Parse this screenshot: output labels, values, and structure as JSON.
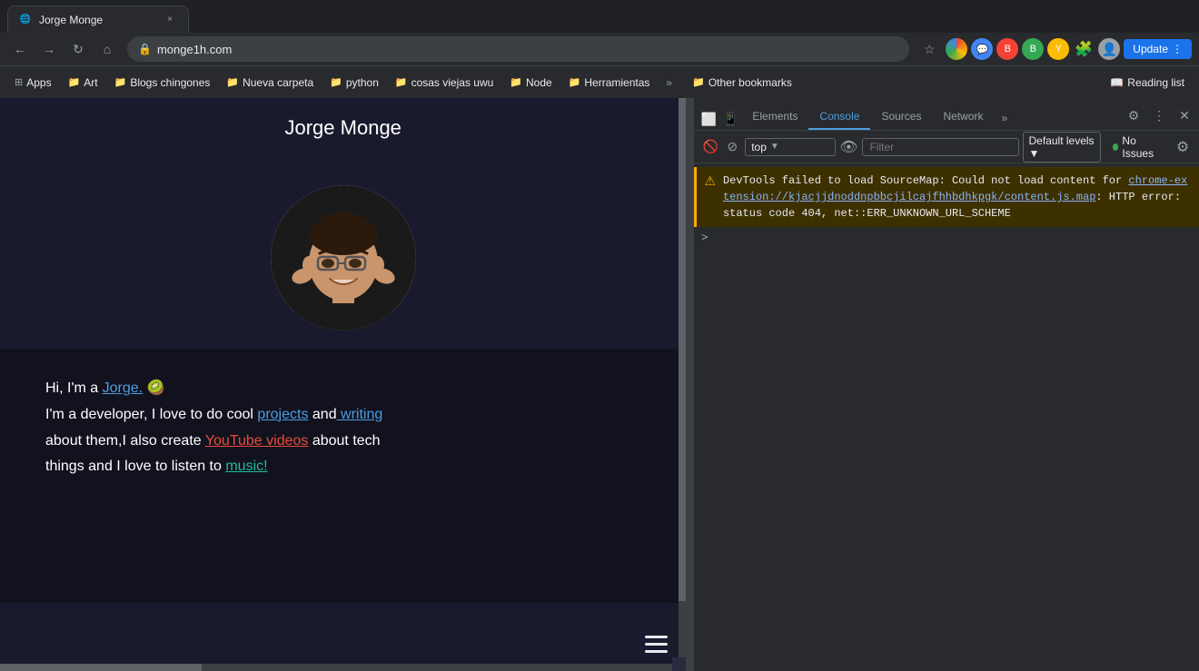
{
  "browser": {
    "address": "monge1h.com",
    "tab_title": "Jorge Monge",
    "back_tooltip": "Back",
    "forward_tooltip": "Forward",
    "refresh_tooltip": "Refresh",
    "home_tooltip": "Home"
  },
  "bookmarks": {
    "items": [
      {
        "id": "apps",
        "icon": "🔲",
        "label": "Apps"
      },
      {
        "id": "art",
        "icon": "📁",
        "label": "Art"
      },
      {
        "id": "blogs",
        "icon": "📁",
        "label": "Blogs chingones"
      },
      {
        "id": "nueva",
        "icon": "📁",
        "label": "Nueva carpeta"
      },
      {
        "id": "python",
        "icon": "📁",
        "label": "python"
      },
      {
        "id": "cosas",
        "icon": "📁",
        "label": "cosas viejas uwu"
      },
      {
        "id": "node",
        "icon": "📁",
        "label": "Node"
      },
      {
        "id": "herramientas",
        "icon": "📁",
        "label": "Herramientas"
      }
    ],
    "more_label": "»",
    "other_bookmarks_label": "Other bookmarks",
    "reading_list_label": "Reading list"
  },
  "website": {
    "title": "Jorge Monge",
    "intro_line1": "Hi, I'm a ",
    "intro_name": "Jorge.",
    "intro_emoji": "🥝",
    "intro_line2": "I'm a developer, I love to do cool ",
    "intro_projects": "projects",
    "intro_and": " and",
    "intro_writing": " writing",
    "intro_line3": " about them,I also create ",
    "intro_youtube": "YouTube videos",
    "intro_line4": " about tech",
    "intro_line5": "things and I love to listen to ",
    "intro_music": "music!",
    "hamburger_label": "menu"
  },
  "devtools": {
    "tabs": [
      {
        "id": "elements",
        "label": "Elements"
      },
      {
        "id": "console",
        "label": "Console",
        "active": true
      },
      {
        "id": "sources",
        "label": "Sources"
      },
      {
        "id": "network",
        "label": "Network"
      }
    ],
    "more_tabs_label": "»",
    "context_selector": "top",
    "filter_placeholder": "Filter",
    "default_levels_label": "Default levels ▼",
    "no_issues_label": "No Issues",
    "warning": {
      "message": "DevTools failed to load SourceMap: Could not load content for ",
      "link_text": "chrome-extension://kjacjjdnoddnpbbcjilcajfhhbdhkpgk/content.js.map",
      "message2": ": HTTP error: status code 404, net::ERR_UNKNOWN_URL_SCHEME"
    },
    "close_label": "×",
    "settings_label": "⚙",
    "undock_label": "⋮"
  },
  "colors": {
    "website_bg": "#1a1a2e",
    "website_content_bg": "#12121f",
    "devtools_bg": "#292a2d",
    "warning_bg": "#3d3000",
    "warning_border": "#f9ab00",
    "accent_blue": "#4d9de0",
    "accent_green": "#2ecc71",
    "accent_red": "#e74c3c",
    "accent_teal": "#1abc9c",
    "link_color": "#8ab4f8"
  }
}
